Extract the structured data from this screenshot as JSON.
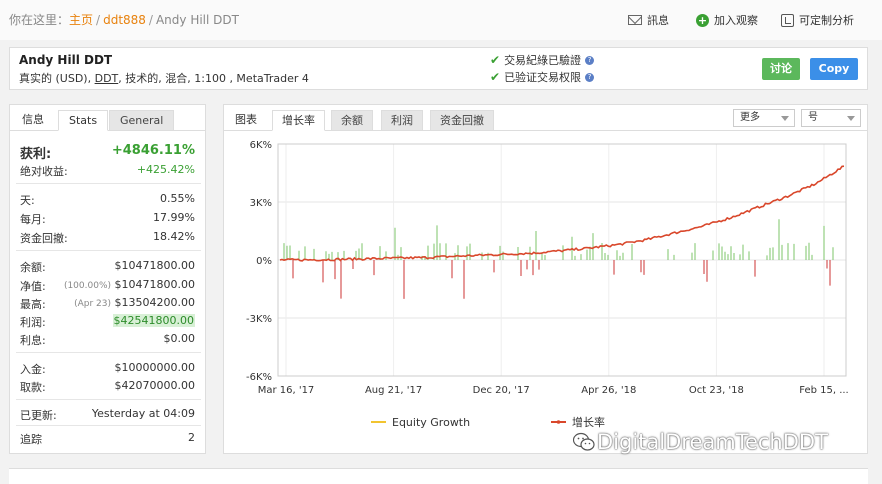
{
  "breadcrumb": {
    "prefix": "你在这里：",
    "home": "主页",
    "sep": "/",
    "user": "ddt888",
    "current": "Andy Hill DDT"
  },
  "topnav": {
    "message": "訊息",
    "watch": "加入观察",
    "custom": "可定制分析"
  },
  "header": {
    "name": "Andy Hill DDT",
    "desc_prefix": "真实的 (USD),",
    "desc_ddt": "DDT",
    "desc_suffix": ", 技术的, 混合, 1:100 , MetaTrader 4",
    "verify_track": "交易紀綠已驗證",
    "verify_access": "已验证交易权限",
    "discuss_btn": "讨论",
    "copy_btn": "Copy"
  },
  "left_tabs": {
    "info": "信息",
    "stats": "Stats",
    "general": "General"
  },
  "stats": {
    "gain_label": "获利:",
    "gain_value": "+4846.11%",
    "abs_label": "绝对收益:",
    "abs_value": "+425.42%",
    "daily_label": "天:",
    "daily_value": "0.55%",
    "monthly_label": "每月:",
    "monthly_value": "17.99%",
    "drawdown_label": "资金回撤:",
    "drawdown_value": "18.42%",
    "balance_label": "余额:",
    "balance_value": "$10471800.00",
    "equity_label": "净值:",
    "equity_sub": "(100.00%)",
    "equity_value": "$10471800.00",
    "highest_label": "最高:",
    "highest_sub": "(Apr 23)",
    "highest_value": "$13504200.00",
    "profit_label": "利润:",
    "profit_value": "$42541800.00",
    "interest_label": "利息:",
    "interest_value": "$0.00",
    "deposits_label": "入金:",
    "deposits_value": "$10000000.00",
    "withdrawals_label": "取款:",
    "withdrawals_value": "$42070000.00",
    "updated_label": "已更新:",
    "updated_value": "Yesterday at 04:09",
    "tracking_label": "追踪",
    "tracking_value": "2"
  },
  "chart_tabs": {
    "label": "图表",
    "growth": "增长率",
    "balance": "余额",
    "profit": "利润",
    "drawdown": "资金回撤",
    "more": "更多",
    "period": "号"
  },
  "colors": {
    "growth_line": "#d9472b",
    "bar_green": "#7cc46a",
    "bar_red": "#cc3333",
    "equity_legend": "#f2c430"
  },
  "chart_data": {
    "type": "line",
    "x_ticks": [
      "Mar 16, '17",
      "Aug 21, '17",
      "Dec 20, '17",
      "Apr 26, '18",
      "Oct 23, '18",
      "Feb 15, ..."
    ],
    "y_ticks": [
      "6K%",
      "3K%",
      "0%",
      "-3K%",
      "-6K%"
    ],
    "ylim": [
      -6000,
      6000
    ],
    "grid": true,
    "legend_position": "bottom",
    "series": [
      {
        "name": "Equity Growth",
        "color": "#f2c430",
        "values": []
      },
      {
        "name": "增长率",
        "color": "#d9472b",
        "x": [
          0,
          0.05,
          0.1,
          0.15,
          0.2,
          0.25,
          0.3,
          0.35,
          0.4,
          0.45,
          0.5,
          0.55,
          0.6,
          0.65,
          0.7,
          0.75,
          0.8,
          0.85,
          0.9,
          0.95,
          1.0
        ],
        "values": [
          0,
          10,
          30,
          60,
          90,
          120,
          180,
          240,
          300,
          360,
          480,
          620,
          800,
          1050,
          1400,
          1750,
          2200,
          2750,
          3300,
          3950,
          4846
        ]
      }
    ]
  },
  "watermark": "DigitalDreamTechDDT"
}
